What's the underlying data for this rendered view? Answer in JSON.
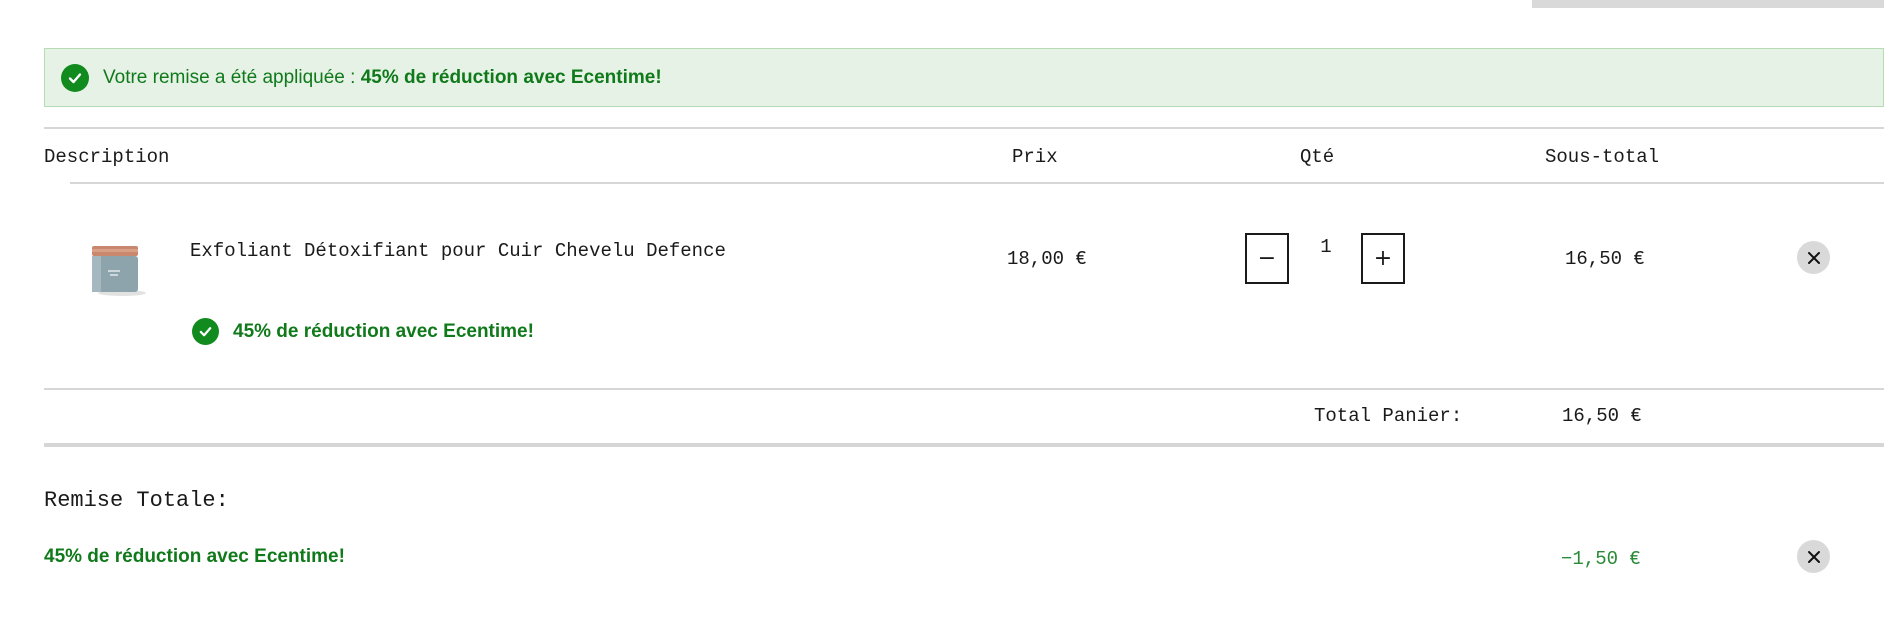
{
  "notice": {
    "prefix": "Votre remise a été appliquée : ",
    "highlight": "45% de réduction avec Ecentime!"
  },
  "table": {
    "headers": {
      "description": "Description",
      "price": "Prix",
      "qty": "Qté",
      "subtotal": "Sous-total"
    },
    "items": [
      {
        "name": "Exfoliant Détoxifiant pour Cuir Chevelu Defence",
        "promo": "45% de réduction avec Ecentime!",
        "price": "18,00 €",
        "qty": "1",
        "subtotal": "16,50 €",
        "decrement_label": "−",
        "increment_label": "+"
      }
    ]
  },
  "total": {
    "label": "Total Panier:",
    "value": "16,50 €"
  },
  "discount": {
    "title": "Remise Totale:",
    "name": "45% de réduction avec Ecentime!",
    "amount": "−1,50 €"
  },
  "colors": {
    "success_green": "#107a1b",
    "notice_bg": "#e6f2e6",
    "divider": "#d6d6d6"
  },
  "icons": {
    "check": "check-circle-icon",
    "remove": "close-icon",
    "product": "product-jar-image"
  }
}
